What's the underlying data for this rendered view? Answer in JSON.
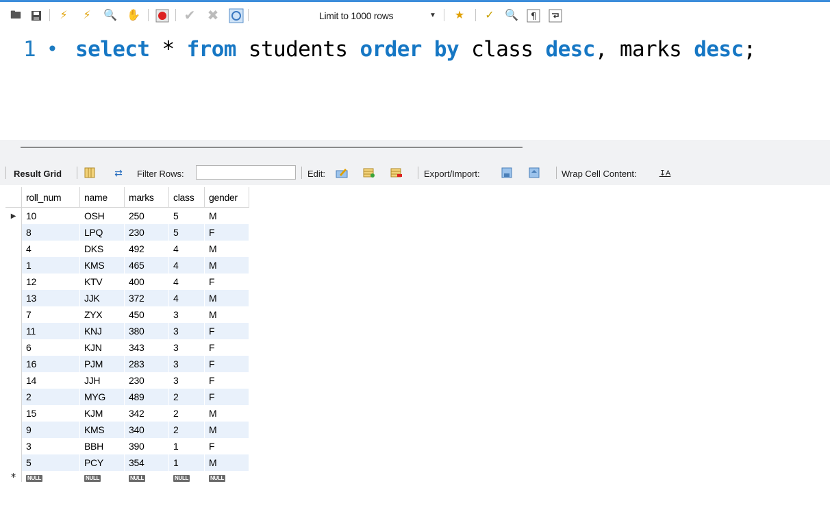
{
  "toolbar": {
    "icons": [
      "folder-open-icon",
      "save-icon",
      "execute-icon",
      "execute-current-icon",
      "explain-icon",
      "stop-icon",
      "toggle-error-icon",
      "commit-icon",
      "rollback-icon",
      "autocommit-icon",
      "add-snippet-icon",
      "beautify-icon",
      "find-icon",
      "invisible-chars-icon",
      "wrap-icon"
    ],
    "limit_label": "Limit to 1000 rows"
  },
  "editor": {
    "line_number": "1",
    "tokens": [
      {
        "t": "select",
        "kw": true
      },
      {
        "t": " * ",
        "kw": false
      },
      {
        "t": "from",
        "kw": true
      },
      {
        "t": " students ",
        "kw": false
      },
      {
        "t": "order",
        "kw": true
      },
      {
        "t": " ",
        "kw": false
      },
      {
        "t": "by",
        "kw": true
      },
      {
        "t": " class ",
        "kw": false
      },
      {
        "t": "desc",
        "kw": true
      },
      {
        "t": ", marks ",
        "kw": false
      },
      {
        "t": "desc",
        "kw": true
      },
      {
        "t": ";",
        "kw": false
      }
    ]
  },
  "result_toolbar": {
    "result_grid": "Result Grid",
    "filter_rows": "Filter Rows:",
    "filter_value": "",
    "edit": "Edit:",
    "export_import": "Export/Import:",
    "wrap": "Wrap Cell Content:"
  },
  "grid": {
    "columns": [
      "roll_num",
      "name",
      "marks",
      "class",
      "gender"
    ],
    "rows": [
      [
        "10",
        "OSH",
        "250",
        "5",
        "M"
      ],
      [
        "8",
        "LPQ",
        "230",
        "5",
        "F"
      ],
      [
        "4",
        "DKS",
        "492",
        "4",
        "M"
      ],
      [
        "1",
        "KMS",
        "465",
        "4",
        "M"
      ],
      [
        "12",
        "KTV",
        "400",
        "4",
        "F"
      ],
      [
        "13",
        "JJK",
        "372",
        "4",
        "M"
      ],
      [
        "7",
        "ZYX",
        "450",
        "3",
        "M"
      ],
      [
        "11",
        "KNJ",
        "380",
        "3",
        "F"
      ],
      [
        "6",
        "KJN",
        "343",
        "3",
        "F"
      ],
      [
        "16",
        "PJM",
        "283",
        "3",
        "F"
      ],
      [
        "14",
        "JJH",
        "230",
        "3",
        "F"
      ],
      [
        "2",
        "MYG",
        "489",
        "2",
        "F"
      ],
      [
        "15",
        "KJM",
        "342",
        "2",
        "M"
      ],
      [
        "9",
        "KMS",
        "340",
        "2",
        "M"
      ],
      [
        "3",
        "BBH",
        "390",
        "1",
        "F"
      ],
      [
        "5",
        "PCY",
        "354",
        "1",
        "M"
      ]
    ],
    "null_label": "NULL",
    "colors": {
      "alt_row": "#e9f1fb",
      "keyword": "#1677c4",
      "line_number": "#1d7bc1"
    }
  }
}
